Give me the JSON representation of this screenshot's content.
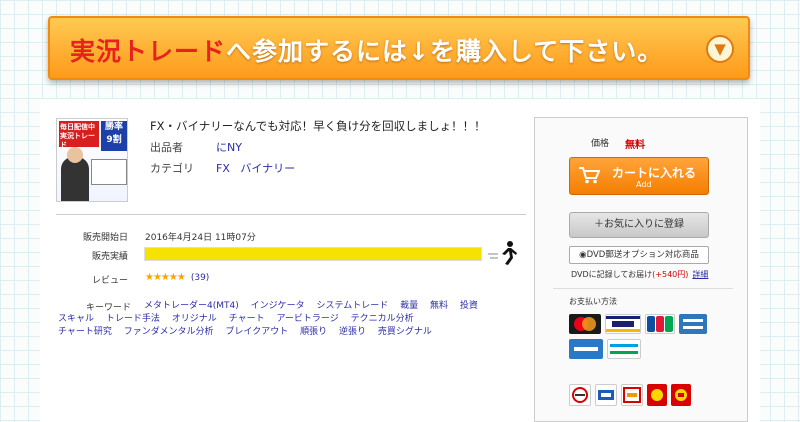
{
  "banner": {
    "highlight": "実況トレード",
    "rest": "へ参加するには↓を購入して下さい。",
    "icon": "chevron-down-icon"
  },
  "product": {
    "thumb_label_1": "毎日配信中 実況トレード",
    "thumb_label_2": "勝率 9割",
    "title": "FX・バイナリーなんでも対応！早く負け分を回収しましょ！！！",
    "seller_label": "出品者",
    "seller": "にNY",
    "category_label": "カテゴリ",
    "categories": [
      "FX",
      "バイナリー"
    ]
  },
  "details": {
    "sale_start_label": "販売開始日",
    "sale_start": "2016年4月24日 11時07分",
    "sales_label": "販売実績",
    "sales_fill_fraction": 1.0,
    "review_label": "レビュー",
    "review_stars": "★★★★★",
    "review_count": "(39)",
    "keyword_label": "キーワード",
    "keywords": [
      "メタトレーダー4(MT4)",
      "インジケータ",
      "システムトレード",
      "裁量",
      "無料",
      "投資",
      "スキャル",
      "トレード手法",
      "オリジナル",
      "チャート",
      "アービトラージ",
      "テクニカル分析",
      "チャート研究",
      "ファンダメンタル分析",
      "ブレイクアウト",
      "順張り",
      "逆張り",
      "売買シグナル"
    ]
  },
  "purchase": {
    "price_label": "価格",
    "price": "無料",
    "cart_label": "カートに入れる",
    "cart_sub": "Add",
    "favorite_label": "＋お気に入りに登録",
    "dvd_option": "DVD郵送オプション対応商品",
    "dvd_note": "DVDに記録してお届け",
    "dvd_price": "(+540円)",
    "dvd_detail": "詳細",
    "payment_label": "お支払い方法",
    "payment_methods": [
      "MasterCard",
      "VISA",
      "JCB",
      "AMERICAN EXPRESS",
      "銀行振込",
      "FamilyMart",
      "コンビニ",
      "ローソン",
      "サークルK",
      "デイリー"
    ]
  },
  "colors": {
    "banner_orange": "#fe9a1a",
    "accent_red": "#e8231e",
    "link_blue": "#2c2ca8",
    "bar_yellow": "#f5e200",
    "cart_orange": "#f47e00"
  }
}
